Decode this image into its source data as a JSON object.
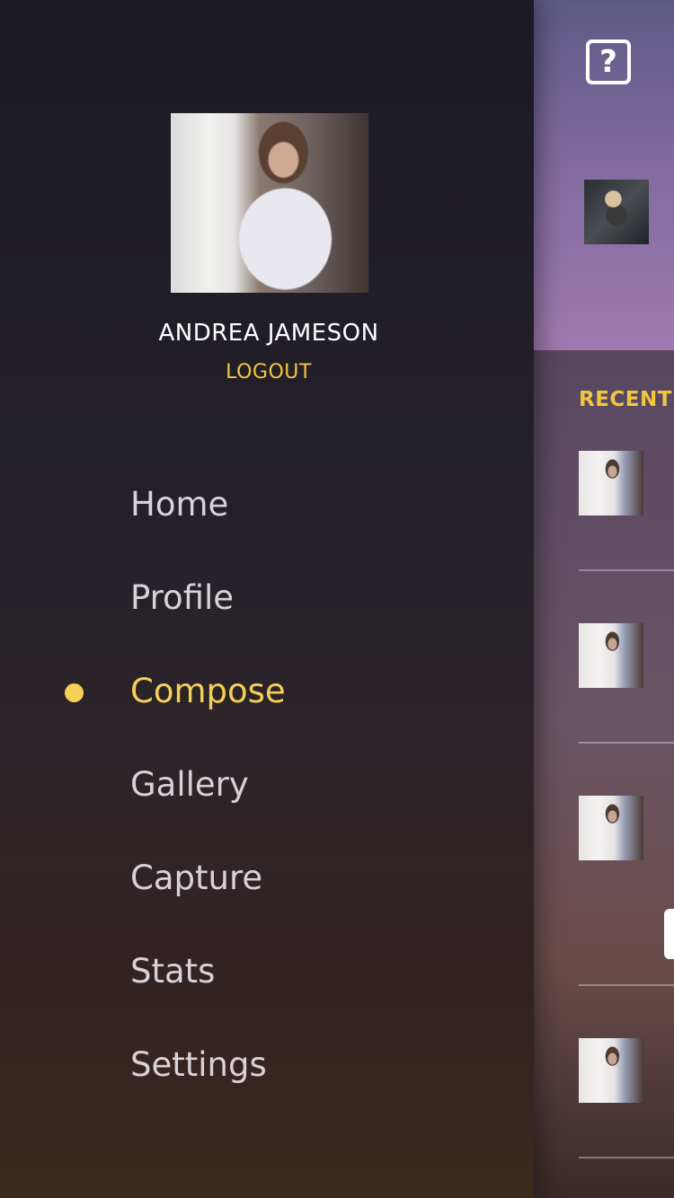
{
  "drawer": {
    "user_name": "ANDREA JAMESON",
    "logout_label": "LOGOUT",
    "nav_items": [
      {
        "label": "Home"
      },
      {
        "label": "Profile"
      },
      {
        "label": "Compose",
        "active": true
      },
      {
        "label": "Gallery"
      },
      {
        "label": "Capture"
      },
      {
        "label": "Stats"
      },
      {
        "label": "Settings"
      }
    ]
  },
  "main": {
    "help_icon": "question-mark-icon",
    "help_glyph": "?",
    "section_title": "RECENT C"
  },
  "colors": {
    "accent": "#f6cf56",
    "drawer_bg": "#1c1a23",
    "header_bg": "#7f6a9f"
  }
}
